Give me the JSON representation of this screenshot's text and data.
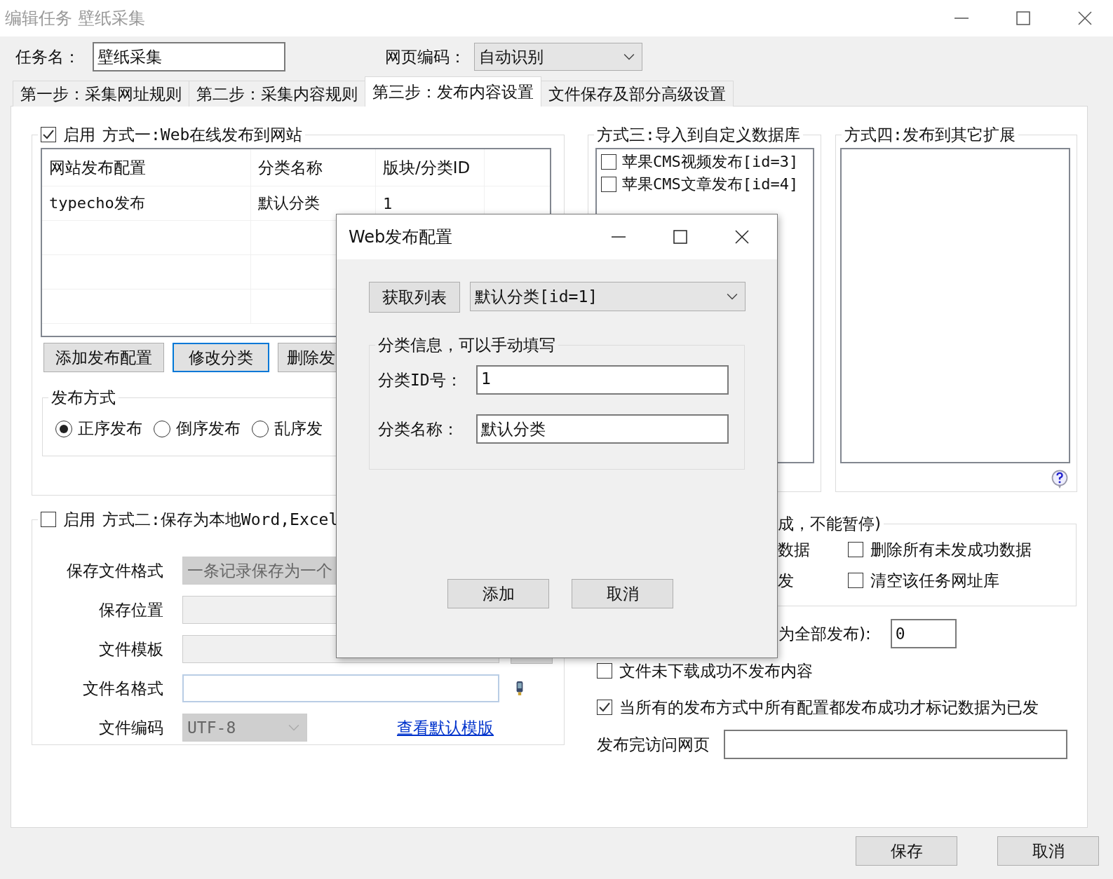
{
  "window": {
    "title": "编辑任务 壁纸采集"
  },
  "task_name": {
    "label": "任务名：",
    "value": "壁纸采集"
  },
  "encoding": {
    "label": "网页编码：",
    "value": "自动识别"
  },
  "tabs": [
    {
      "label": "第一步：采集网址规则",
      "selected": false
    },
    {
      "label": "第二步：采集内容规则",
      "selected": false
    },
    {
      "label": "第三步：发布内容设置",
      "selected": true
    },
    {
      "label": "文件保存及部分高级设置",
      "selected": false
    }
  ],
  "method1": {
    "enabled": true,
    "enable_label": "启用",
    "title": "方式一:Web在线发布到网站",
    "table": {
      "columns": [
        "网站发布配置",
        "分类名称",
        "版块/分类ID"
      ],
      "rows": [
        [
          "typecho发布",
          "默认分类",
          "1"
        ]
      ]
    },
    "buttons": [
      {
        "label": "添加发布配置",
        "focused": false
      },
      {
        "label": "修改分类",
        "focused": true
      },
      {
        "label": "删除发",
        "focused": false
      }
    ],
    "publish_order": {
      "title": "发布方式",
      "options": [
        {
          "label": "正序发布",
          "selected": true
        },
        {
          "label": "倒序发布",
          "selected": false
        },
        {
          "label": "乱序发",
          "selected": false
        }
      ]
    }
  },
  "method2": {
    "enabled": false,
    "enable_label": "启用",
    "title": "方式二:保存为本地Word,Excel",
    "fields": [
      {
        "label": "保存文件格式",
        "kind": "select",
        "value": "一条记录保存为一个",
        "disabled": true
      },
      {
        "label": "保存位置",
        "kind": "text",
        "disabled": true
      },
      {
        "label": "文件模板",
        "kind": "browse",
        "disabled": true
      },
      {
        "label": "文件名格式",
        "kind": "tag",
        "disabled": false
      },
      {
        "label": "文件编码",
        "kind": "encoding",
        "value": "UTF-8",
        "disabled": true,
        "link": "查看默认模版"
      }
    ]
  },
  "method3": {
    "title": "方式三:导入到自定义数据库",
    "items": [
      {
        "label": "苹果CMS视频发布[id=3]",
        "checked": false
      },
      {
        "label": "苹果CMS文章发布[id=4]",
        "checked": false
      }
    ]
  },
  "method4": {
    "title": "方式四:发布到其它扩展"
  },
  "cleanup": {
    "title": "成，不能暂停)",
    "rows": [
      {
        "partial": "数据",
        "label": "删除所有未发成功数据",
        "checked": false
      },
      {
        "partial": "发",
        "label": "清空该任务网址库",
        "checked": false
      }
    ]
  },
  "publish_count": {
    "label": "为全部发布):",
    "value": "0"
  },
  "options": [
    {
      "label": "文件未下载成功不发布内容",
      "checked": false
    },
    {
      "label": "当所有的发布方式中所有配置都发布成功才标记数据为已发",
      "checked": true
    }
  ],
  "visit_page": {
    "label": "发布完访问网页"
  },
  "footer_buttons": [
    "保存",
    "取消"
  ],
  "dialog": {
    "title": "Web发布配置",
    "fetch_button": "获取列表",
    "category": "默认分类[id=1]",
    "group_title": "分类信息，可以手动填写",
    "fields": [
      {
        "label": "分类ID号：",
        "value": "1"
      },
      {
        "label": "分类名称：",
        "value": "默认分类"
      }
    ],
    "buttons": [
      "添加",
      "取消"
    ]
  }
}
